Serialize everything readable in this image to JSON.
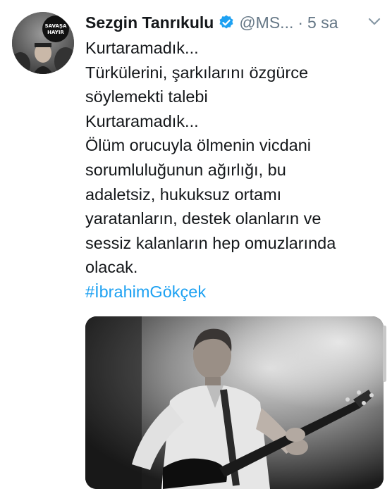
{
  "tweet": {
    "author_name": "Sezgin Tanrıkulu",
    "handle": "@MS...",
    "separator": "·",
    "time": "5 sa",
    "verified_icon": "verified-badge-icon",
    "menu_icon": "chevron-down-icon",
    "lines": [
      "Kurtaramadık...",
      "Türkülerini, şarkılarını özgürce",
      "söylemekti talebi",
      "Kurtaramadık...",
      "Ölüm orucuyla ölmenin vicdani",
      "sorumluluğunun ağırlığı, bu",
      "adaletsiz, hukuksuz ortamı",
      "yaratanların, destek olanların ve",
      "sessiz kalanların hep omuzlarında",
      "olacak."
    ],
    "hashtag": "#İbrahimGökçek"
  },
  "avatar": {
    "sign_text": "SAVAŞA HAYIR"
  },
  "colors": {
    "link": "#1da1f2",
    "muted": "#657786",
    "text": "#14171a"
  }
}
